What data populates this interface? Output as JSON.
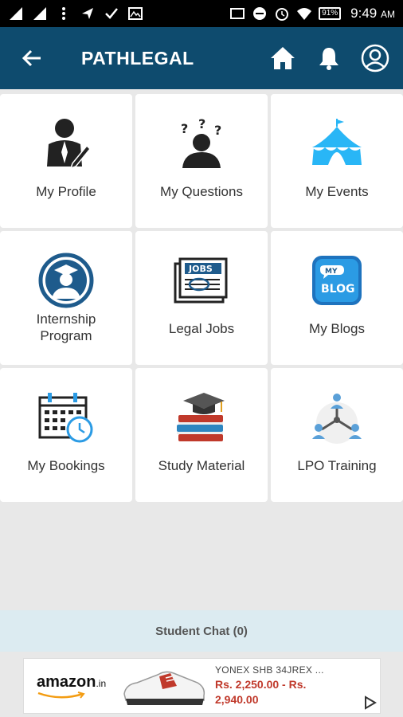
{
  "status_bar": {
    "time": "9:49",
    "time_suffix": "AM",
    "battery": "91%"
  },
  "header": {
    "title": "PATHLEGAL"
  },
  "tiles": [
    {
      "label": "My Profile",
      "icon": "profile-icon"
    },
    {
      "label": "My Questions",
      "icon": "questions-icon"
    },
    {
      "label": "My Events",
      "icon": "events-tent-icon"
    },
    {
      "label": "Internship Program",
      "line1": "Internship",
      "line2": "Program",
      "icon": "graduate-icon"
    },
    {
      "label": "Legal Jobs",
      "icon": "jobs-newspaper-icon"
    },
    {
      "label": "My Blogs",
      "icon": "blog-icon"
    },
    {
      "label": "My Bookings",
      "icon": "calendar-clock-icon"
    },
    {
      "label": "Study Material",
      "icon": "books-cap-icon"
    },
    {
      "label": "LPO Training",
      "icon": "network-people-icon"
    }
  ],
  "chat": {
    "label": "Student Chat (0)"
  },
  "ad": {
    "brand": "amazon",
    "brand_suffix": ".in",
    "product": "YONEX SHB 34JREX ...",
    "price": "Rs. 2,250.00 - Rs. 2,940.00"
  },
  "colors": {
    "appbar": "#0e4b6e",
    "background": "#e8e8e8",
    "chat_bar": "#dcebf1",
    "price": "#c0392b"
  }
}
